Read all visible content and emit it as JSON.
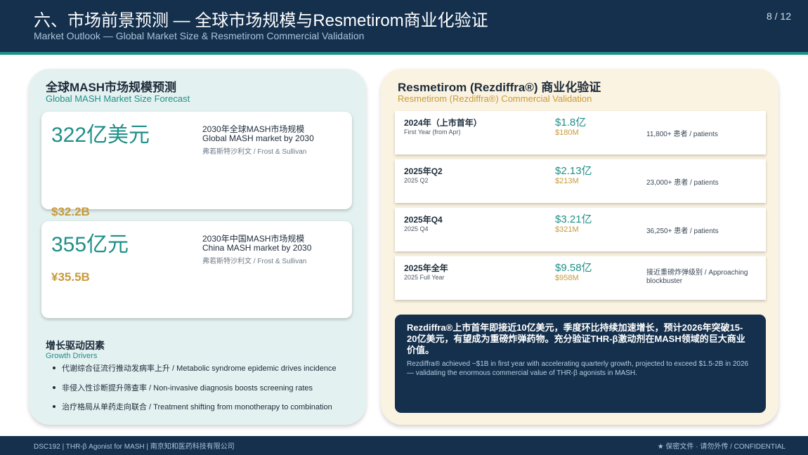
{
  "header": {
    "title": "六、市场前景预测 — 全球市场规模与Resmetirom商业化验证",
    "subtitle": "Market Outlook — Global Market Size & Resmetirom Commercial Validation",
    "page": "8 / 12"
  },
  "left_panel": {
    "title": "全球MASH市场规模预测",
    "subtitle": "Global MASH Market Size Forecast",
    "cards": [
      {
        "value_cny": "322亿美元",
        "value_usd": "$32.2B",
        "desc_zh": "2030年全球MASH市场规模",
        "desc_en": "Global MASH market by 2030",
        "source": "弗若斯特沙利文 / Frost & Sullivan"
      },
      {
        "value_cny": "355亿元",
        "value_usd": "¥35.5B",
        "desc_zh": "2030年中国MASH市场规模",
        "desc_en": "China MASH market by 2030",
        "source": "弗若斯特沙利文 / Frost & Sullivan"
      }
    ],
    "drivers": {
      "title": "增长驱动因素",
      "subtitle": "Growth Drivers",
      "items": [
        "代谢综合征流行推动发病率上升 / Metabolic syndrome epidemic drives incidence",
        "非侵入性诊断提升筛查率 / Non-invasive diagnosis boosts screening rates",
        "治疗格局从单药走向联合 / Treatment shifting from monotherapy to combination"
      ]
    }
  },
  "right_panel": {
    "title": "Resmetirom (Rezdiffra®) 商业化验证",
    "subtitle": "Resmetirom (Rezdiffra®) Commercial Validation",
    "rows": [
      {
        "period": "2024年（上市首年）",
        "period_en": "First Year (from Apr)",
        "revenue": "$1.8亿",
        "revenue_usd": "$180M",
        "patients": "11,800+ 患者 / patients"
      },
      {
        "period": "2025年Q2",
        "period_en": "2025 Q2",
        "revenue": "$2.13亿",
        "revenue_usd": "$213M",
        "patients": "23,000+ 患者 / patients"
      },
      {
        "period": "2025年Q4",
        "period_en": "2025 Q4",
        "revenue": "$3.21亿",
        "revenue_usd": "$321M",
        "patients": "36,250+ 患者 / patients"
      },
      {
        "period": "2025年全年",
        "period_en": "2025 Full Year",
        "revenue": "$9.58亿",
        "revenue_usd": "$958M",
        "patients": "接近重磅炸弹级别 / Approaching blockbuster"
      }
    ],
    "summary_zh": "Rezdiffra®上市首年即接近10亿美元，季度环比持续加速增长，预计2026年突破15-20亿美元，有望成为重磅炸弹药物。充分验证THR-β激动剂在MASH领域的巨大商业价值。",
    "summary_en": "Rezdiffra® achieved ~$1B in first year with accelerating quarterly growth, projected to exceed $1.5-2B in 2026 — validating the enormous commercial value of THR-β agonists in MASH."
  },
  "footer": {
    "left": "DSC192 | THR-β Agonist for MASH | 南京知和医药科技有限公司",
    "right": "★ 保密文件 · 请勿外传 / CONFIDENTIAL"
  }
}
